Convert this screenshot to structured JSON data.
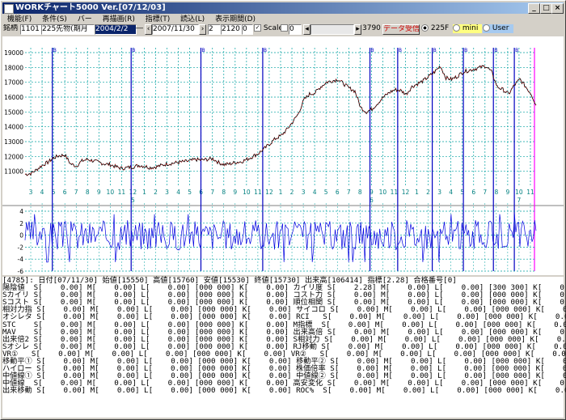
{
  "window": {
    "title": "WORKチャート5000  Ver.[07/12/03]"
  },
  "menu": [
    "機能(F)",
    "条件(S)",
    "バー",
    "再描画(R)",
    "指標(T)",
    "読込(L)",
    "表示期間(D)"
  ],
  "toolbar": {
    "code_label": "銘柄",
    "code_value": "1101",
    "code_name": "225先物(期月",
    "start_date": "2004/2/2",
    "end_date": "2007/11/30",
    "field_a": "2",
    "field_b": "2120",
    "field_c": "0",
    "scale_label": "Scale",
    "scale_value": "0",
    "count": "3790",
    "receive_label": "データ受信",
    "radio_225f": "225F",
    "radio_mini": "mini",
    "radio_user": "User"
  },
  "chart_data": [
    {
      "type": "line",
      "role": "price",
      "ylim": [
        10000,
        19000
      ],
      "y_ticks": [
        19000,
        18000,
        17000,
        16000,
        15000,
        14000,
        13000,
        12000,
        11000
      ],
      "x_month_ticks": [
        "3",
        "4",
        "5",
        "6",
        "7",
        "8",
        "9",
        "10",
        "11",
        "12",
        "1",
        "2",
        "3",
        "4",
        "5",
        "6",
        "7",
        "8",
        "9",
        "10",
        "11",
        "12",
        "1",
        "2",
        "3",
        "4",
        "5",
        "6",
        "7",
        "8",
        "9",
        "10",
        "11",
        "12",
        "1",
        "2",
        "3",
        "4",
        "5",
        "6",
        "7",
        "8",
        "9",
        "10",
        "11"
      ],
      "x_year_labels": [
        "5",
        "6",
        "7"
      ],
      "marker_label": "B",
      "series": [
        {
          "values": [
            10800,
            10850,
            11100,
            11400,
            11600,
            11900,
            12050,
            12100,
            11500,
            11350,
            11700,
            11800,
            11700,
            11600,
            11500,
            11450,
            11300,
            11200,
            11250,
            11300,
            11400,
            11350,
            11250,
            11300,
            11400,
            11500,
            11550,
            11600,
            11650,
            11700,
            11800,
            11750,
            11800,
            11850,
            11600,
            11450,
            11500,
            11600,
            11650,
            11800,
            12000,
            12200,
            12500,
            12850,
            13200,
            13400,
            13800,
            14300,
            14850,
            15800,
            16200,
            16300,
            16700,
            17000,
            17100,
            17200,
            16900,
            16600,
            16400,
            15300,
            15000,
            15200,
            15600,
            16000,
            16300,
            16500,
            16450,
            16200,
            16700,
            16900,
            17100,
            17400,
            17700,
            18100,
            17300,
            17200,
            17400,
            17700,
            17800,
            17900,
            18000,
            18100,
            17700,
            16700,
            16500,
            16200,
            16800,
            17200,
            16700,
            16200,
            15300
          ]
        }
      ]
    },
    {
      "type": "line",
      "role": "oscillator",
      "ylim": [
        -6,
        4
      ],
      "y_ticks": [
        4,
        2,
        0,
        -2,
        -4,
        -6
      ]
    }
  ],
  "info": {
    "rows": [
      "[4785]: 日付[07/11/30] 始値[15550] 高値[15760] 安値[15530] 終値[15730] 出来高[106414] 指標[2.28] 合格番号[0]",
      "陽陰値  S[    0.00] M[    0.00] L[    0.00] [000 000] K[    0.00] カイリ度 S[    2.28] M[    0.00] L[    0.00] [300 300] K[    0.00]",
      "Sカイリ S[    0.00] M[    0.00] L[    0.00] [000 000] K[    0.00] コスト力 S[    0.00] M[    0.00] L[    0.00] [000 000] K[    0.00]",
      "Sコスト S[    0.00] M[    0.00] L[    0.00] [000 000] K[    0.00] 順位相関 S[    0.00] M[    0.00] L[    0.00] [000 000] K[    0.00]",
      "相対力指 S[    0.00] M[    0.00] L[    0.00] [000 000] K[    0.00] サイコロ S[    0.00] M[    0.00] L[    0.00] [000 000] K[    0.00]",
      "オシレタ S[    0.00] M[    0.00] L[    0.00] [000 000] K[    0.00] RCI   S[    0.00] M[    0.00] L[    0.00] [000 000] K[    0.00]",
      "STC    S[    0.00] M[    0.00] L[    0.00] [000 000] K[    0.00] M指標  S[    0.00] M[    0.00] L[    0.00] [000 000] K[    0.00]",
      "MAV    S[    0.00] M[    0.00] L[    0.00] [000 000] K[    0.00] 出来高倍 S[    0.00] M[    0.00] L[    0.00] [000 000] K[    0.00]",
      "出来倍2 S[    0.00] M[    0.00] L[    0.00] [000 000] K[    0.00] S相対力 S[    0.00] M[    0.00] L[    0.00] [000 000] K[    0.00]",
      "Sオシレ S[    0.00] M[    0.00] L[    0.00] [000 000] K[    0.00] RJ移動 S[    0.00] M[    0.00] L[    0.00] [000 000] K[    0.00]",
      "VR①   S[    0.00] M[    0.00] L[    0.00] [000 000] K[    0.00] VR②   S[    0.00] M[    0.00] L[    0.00] [000 000] K[    0.00]",
      "移動平① S[    0.00] M[    0.00] L[    0.00] [000 000] K[    0.00] 移動平② S[    0.00] M[    0.00] L[    0.00] [000 000] K[    0.00]",
      "ハイロー S[    0.00] M[    0.00] L[    0.00] [000 000] K[    0.00] 株価倍率 S[    0.00] M[    0.00] L[    0.00] [000 000] K[    0.00]",
      "中値線① S[    0.00] M[    0.00] L[    0.00] [000 000] K[    0.00] 中値線② S[    0.00] M[    0.00] L[    0.00] [000 000] K[    0.00]",
      "中値線  S[    0.00] M[    0.00] L[    0.00] [000 000] K[    0.00] 高安変化 S[    0.00] M[    0.00] L[    0.00] [000 000] K[    0.00]",
      "出来移動 S[    0.00] M[    0.00] L[    0.00] [000 000] K[    0.00] ROC%  S[    0.00] M[    0.00] L[    0.00] [000 000] K[    0.00]"
    ]
  }
}
